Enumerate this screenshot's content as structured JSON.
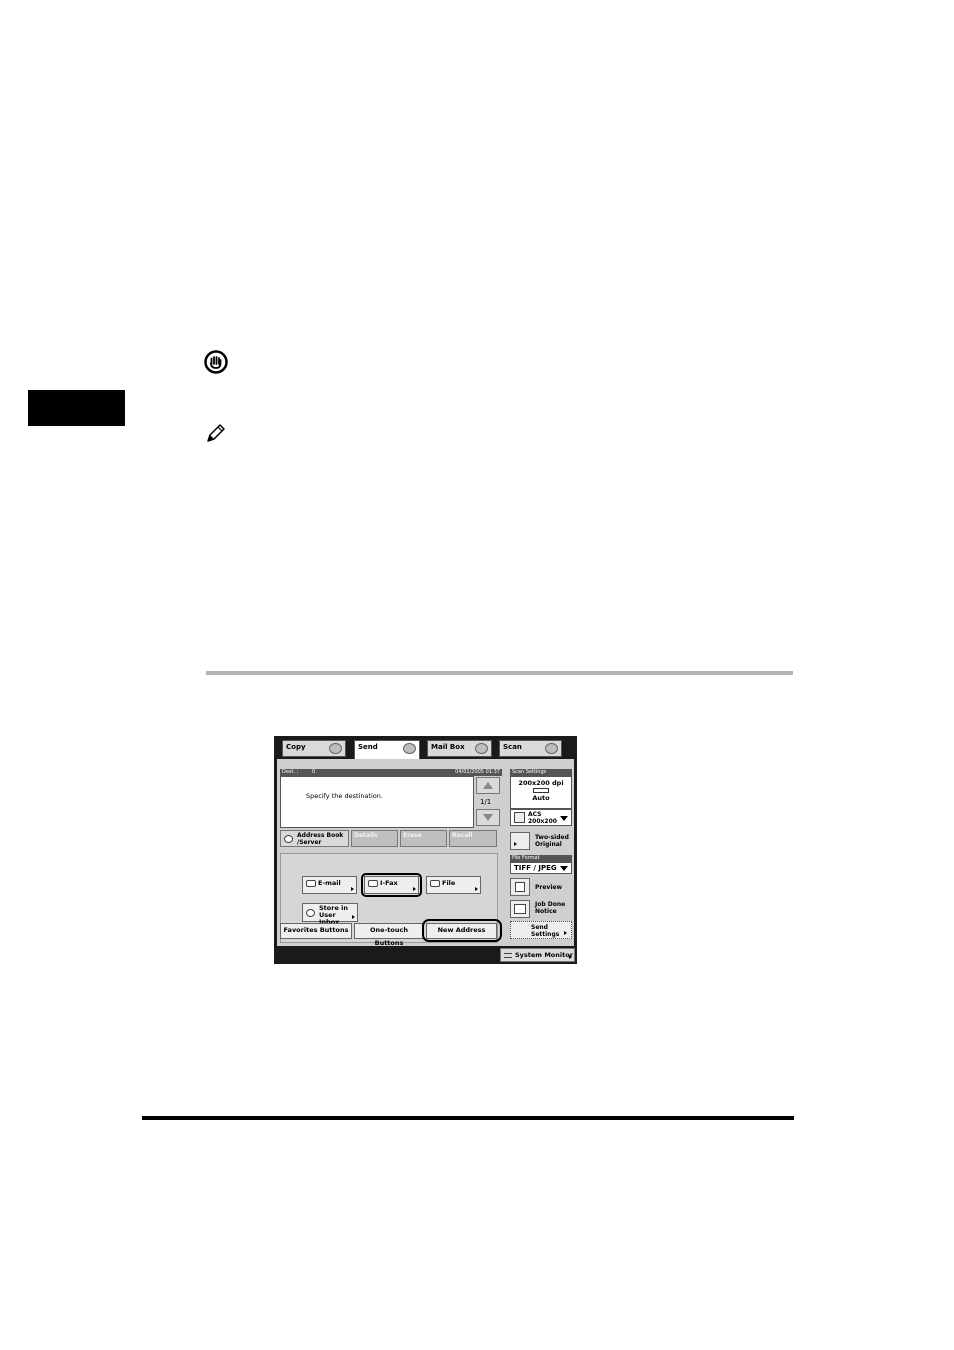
{
  "panel": {
    "tabs": [
      {
        "label": "Copy",
        "icon": "copy-icon"
      },
      {
        "label": "Send",
        "icon": "send-icon",
        "active": true
      },
      {
        "label": "Mail Box",
        "icon": "mailbox-icon"
      },
      {
        "label": "Scan",
        "icon": "scan-icon"
      }
    ],
    "dest_label": "Dest. :",
    "dest_count": "0",
    "datetime": "04/01/2005 01:37",
    "message": "Specify the destination.",
    "page_indicator": "1/1",
    "dest_buttons": [
      {
        "label": "Address Book /Server",
        "enabled": true
      },
      {
        "label": "Details",
        "enabled": false
      },
      {
        "label": "Erase",
        "enabled": false
      },
      {
        "label": "Recall",
        "enabled": false
      }
    ],
    "type_buttons": {
      "email": "E-mail",
      "ifax": "I-Fax",
      "file": "File",
      "store": "Store in User Inbox"
    },
    "bottom_buttons": {
      "favorites": "Favorites Buttons",
      "onetouch": "One-touch Buttons",
      "new_address": "New Address"
    },
    "scan_settings": {
      "label": "Scan Settings",
      "resolution": "200x200 dpi",
      "paper": "Auto",
      "mode": "ACS",
      "mode_res": "200x200"
    },
    "two_sided": "Two-sided Original",
    "file_format": {
      "label": "File Format",
      "value": "TIFF / JPEG"
    },
    "preview": "Preview",
    "job_done": "Job Done Notice",
    "send_settings": "Send Settings",
    "system_monitor": "System Monitor"
  }
}
